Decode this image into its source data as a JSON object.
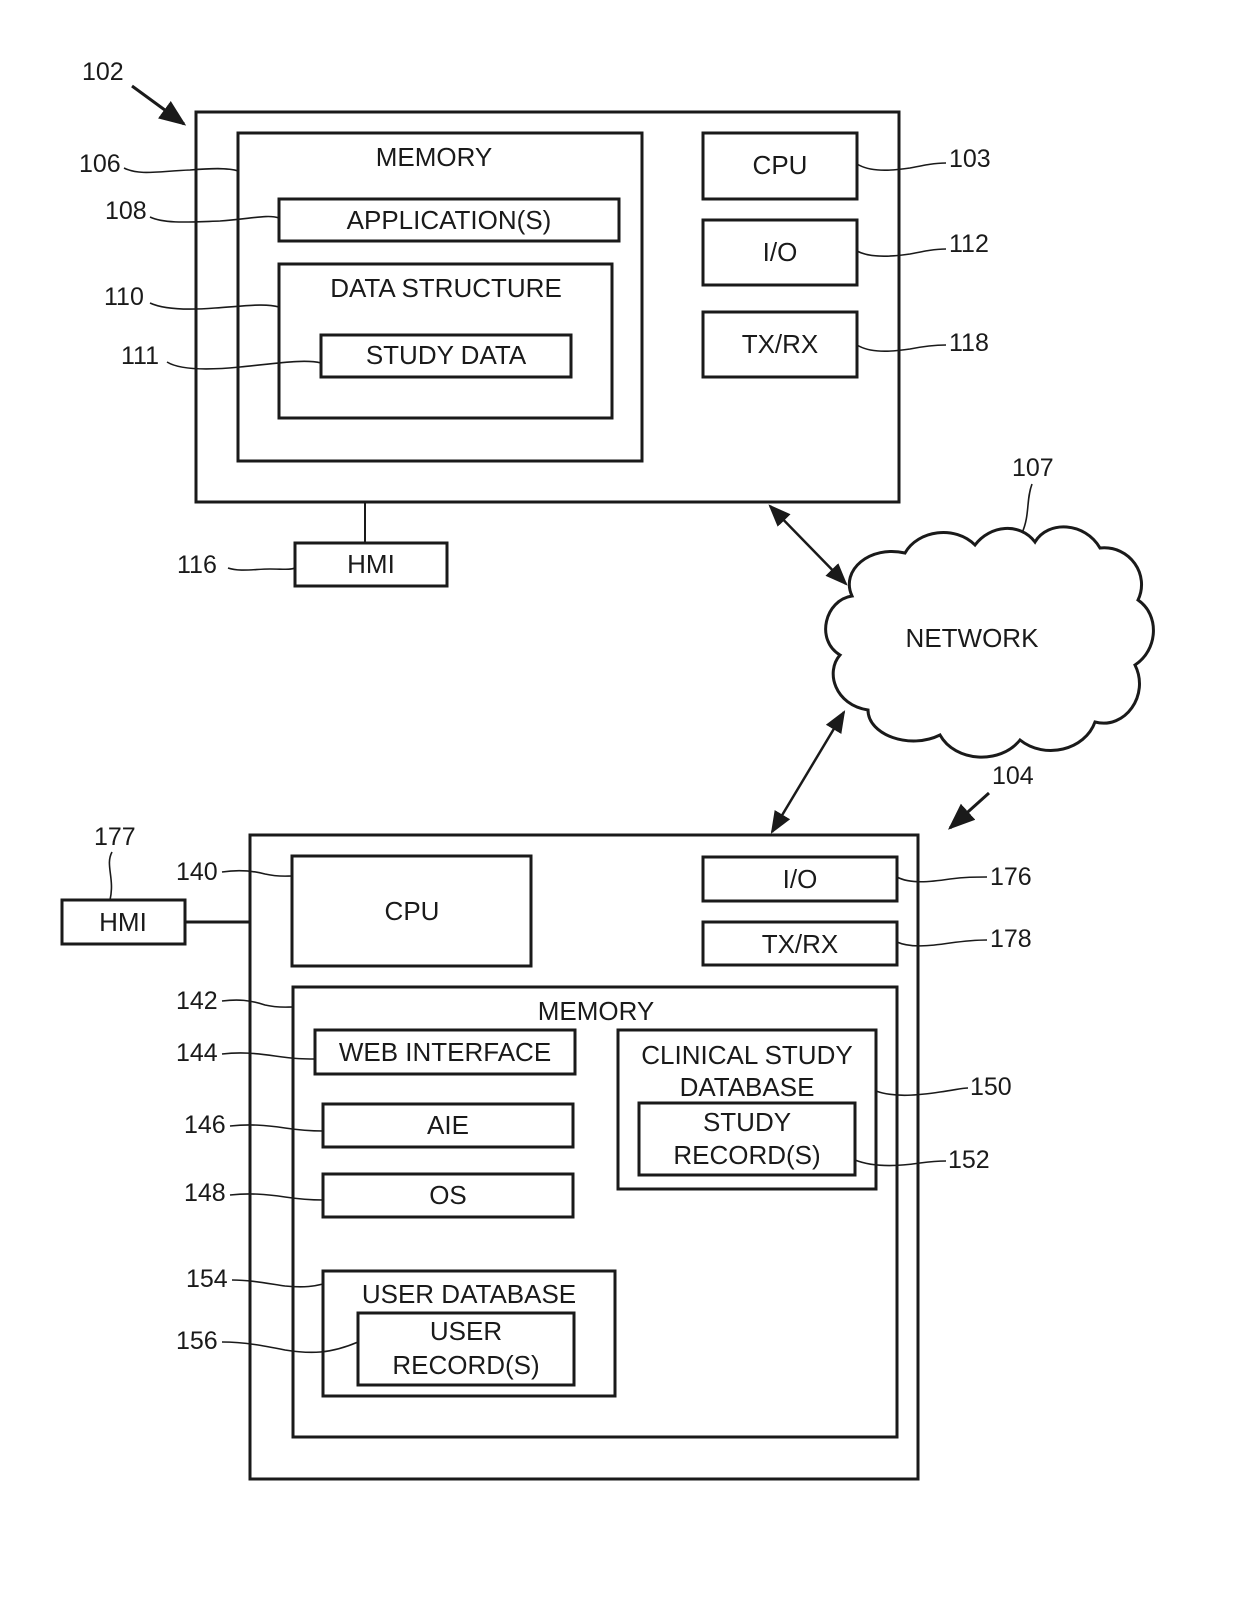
{
  "figure": {
    "system_102": {
      "ref": "102",
      "memory": {
        "ref": "106",
        "label": "MEMORY"
      },
      "applications": {
        "ref": "108",
        "label": "APPLICATION(S)"
      },
      "data_structure": {
        "ref": "110",
        "label": "DATA STRUCTURE"
      },
      "study_data": {
        "ref": "111",
        "label": "STUDY DATA"
      },
      "cpu": {
        "ref": "103",
        "label": "CPU"
      },
      "io": {
        "ref": "112",
        "label": "I/O"
      },
      "txrx": {
        "ref": "118",
        "label": "TX/RX"
      },
      "hmi": {
        "ref": "116",
        "label": "HMI"
      }
    },
    "network": {
      "ref": "107",
      "label": "NETWORK"
    },
    "system_104": {
      "ref": "104",
      "hmi": {
        "ref": "177",
        "label": "HMI"
      },
      "cpu": {
        "ref": "140",
        "label": "CPU"
      },
      "io": {
        "ref": "176",
        "label": "I/O"
      },
      "txrx": {
        "ref": "178",
        "label": "TX/RX"
      },
      "memory": {
        "ref": "142",
        "label": "MEMORY"
      },
      "web_interface": {
        "ref": "144",
        "label": "WEB INTERFACE"
      },
      "aie": {
        "ref": "146",
        "label": "AIE"
      },
      "os": {
        "ref": "148",
        "label": "OS"
      },
      "clinical_db": {
        "ref": "150",
        "label_line1": "CLINICAL STUDY",
        "label_line2": "DATABASE"
      },
      "study_records": {
        "ref": "152",
        "label_line1": "STUDY",
        "label_line2": "RECORD(S)"
      },
      "user_db": {
        "ref": "154",
        "label": "USER DATABASE"
      },
      "user_records": {
        "ref": "156",
        "label_line1": "USER",
        "label_line2": "RECORD(S)"
      }
    }
  }
}
